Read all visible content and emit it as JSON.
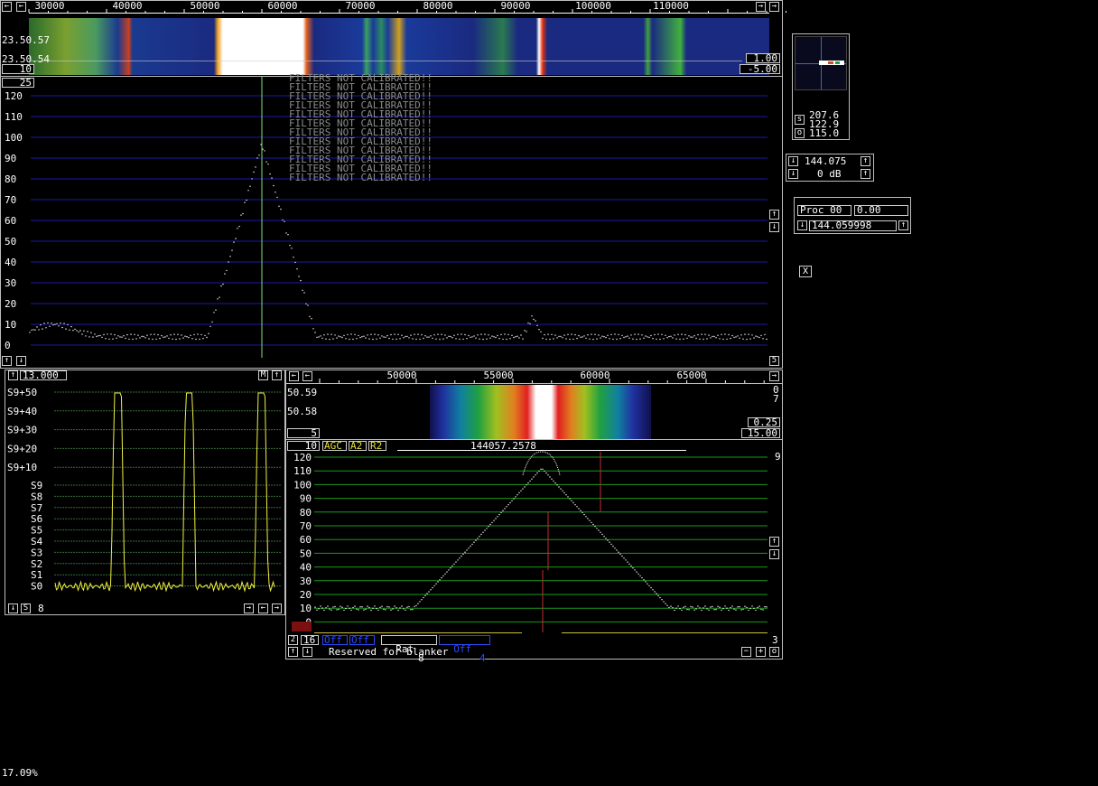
{
  "wide_spectrum": {
    "freq_ticks": [
      "30000",
      "40000",
      "50000",
      "60000",
      "70000",
      "80000",
      "90000",
      "100000",
      "110000"
    ],
    "waterfall_times": [
      "23.50.57",
      "23.50.54"
    ],
    "waterfall_left_box": "10",
    "waterfall_right_top": "1.00",
    "waterfall_right_bottom": "-5.00",
    "ref_box": "25",
    "y_labels": [
      "120",
      "110",
      "100",
      "90",
      "80",
      "70",
      "60",
      "50",
      "40",
      "30",
      "20",
      "10",
      "0"
    ],
    "warning_text": "FILTERS NOT CALIBRATED!!",
    "bottom_right_box": "5"
  },
  "meter_panel": {
    "values": [
      "207.6",
      "122.9",
      "115.0"
    ],
    "row_labels": [
      "s",
      "o"
    ]
  },
  "freq_control": {
    "frequency": "144.075",
    "gain": "0 dB"
  },
  "proc_panel": {
    "label": "Proc 00",
    "value": "0.00",
    "frequency": "144.059998"
  },
  "close_button": "X",
  "s_meter": {
    "top_value": "13.000",
    "m_label": "M",
    "labels_plus": [
      "S9+50",
      "S9+40",
      "S9+30",
      "S9+20",
      "S9+10"
    ],
    "labels_s": [
      "S9",
      "S8",
      "S7",
      "S6",
      "S5",
      "S4",
      "S3",
      "S2",
      "S1",
      "S0"
    ],
    "bottom_s": "S",
    "bottom_value": "8"
  },
  "baseband": {
    "freq_ticks": [
      "50000",
      "55000",
      "60000",
      "65000"
    ],
    "wf_times": [
      "50.59",
      "50.58"
    ],
    "right_values_top": [
      "0",
      "7"
    ],
    "wf_left_box": "5",
    "wf_right_top": "0.25",
    "wf_right_bottom": "15.00",
    "controls": [
      "10",
      "AGC",
      "A2",
      "R2"
    ],
    "frequency_readout": "144057.2578",
    "right_label": "9",
    "y_labels": [
      "120",
      "110",
      "100",
      "90",
      "80",
      "70",
      "60",
      "50",
      "40",
      "30",
      "20",
      "10",
      "0"
    ],
    "bottom_left_1": "2",
    "bottom_left_2": "16",
    "off_labels": [
      "Off",
      "Off"
    ],
    "rat_label": "Rat",
    "rat_value": "8",
    "off_value_label": "Off",
    "off_value": "4",
    "bottom_right_num": "3",
    "reserved_text": "Reserved for blanker"
  },
  "status_percent": "17.09%"
}
